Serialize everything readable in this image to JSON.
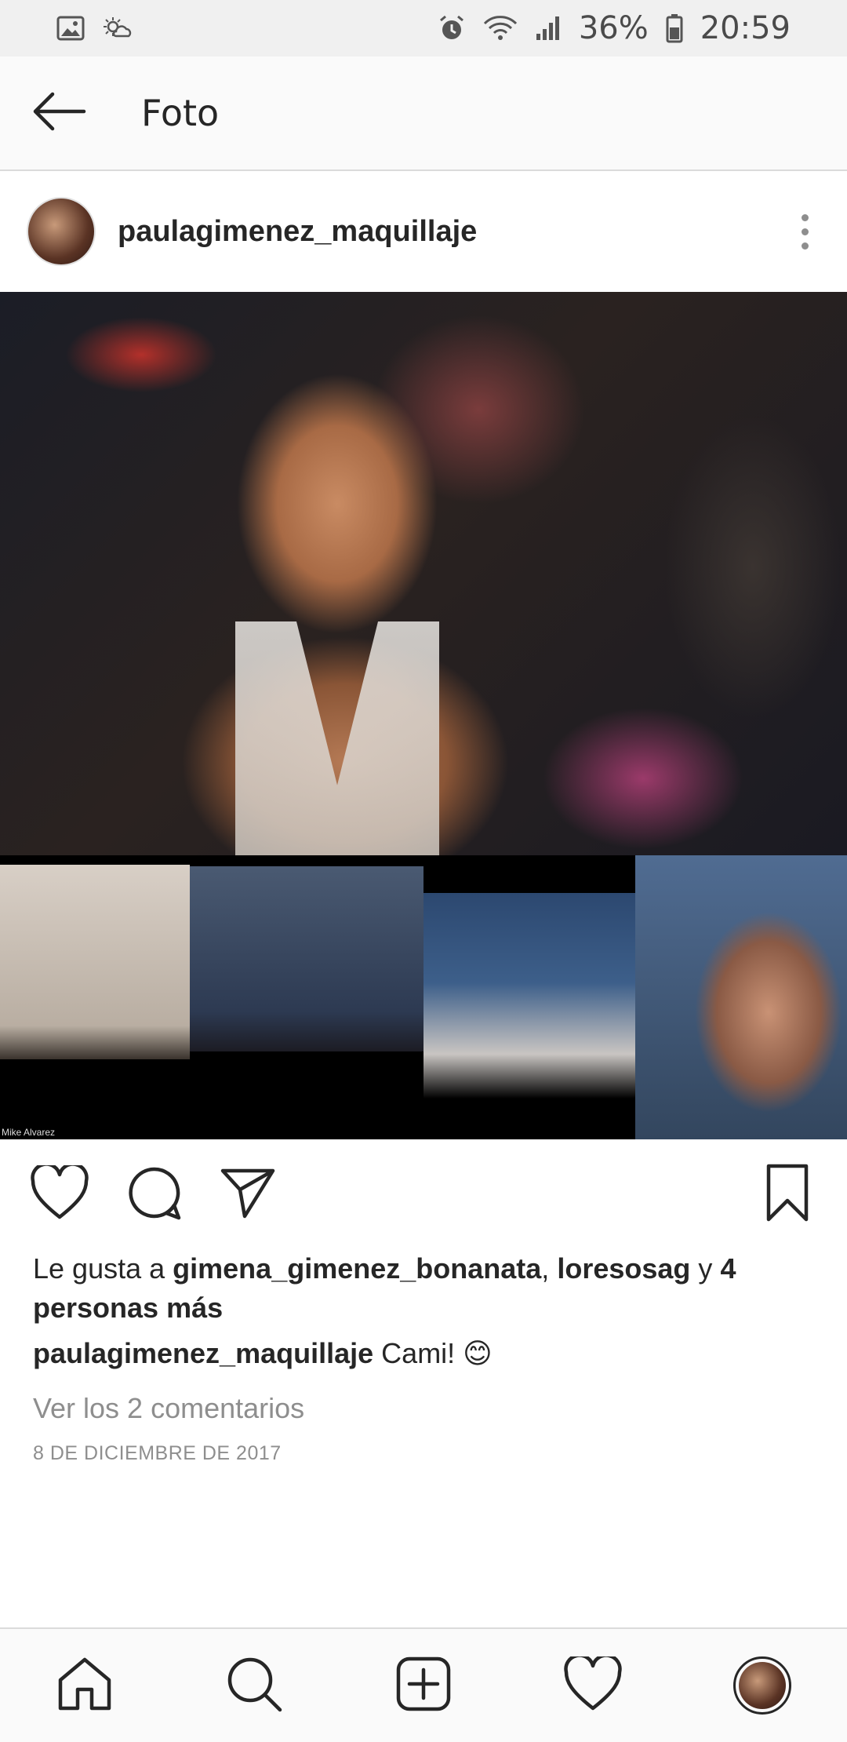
{
  "status_bar": {
    "battery": "36%",
    "time": "20:59",
    "icons": [
      "gallery-icon",
      "weather-icon",
      "alarm-icon",
      "wifi-icon",
      "signal-icon",
      "battery-icon"
    ]
  },
  "header": {
    "title": "Foto",
    "back_icon": "arrow-left-icon"
  },
  "post": {
    "username": "paulagimenez_maquillaje",
    "more_icon": "more-vertical-icon",
    "watermark": "Mike Alvarez",
    "likes": {
      "prefix": "Le gusta a",
      "user1": "gimena_gimenez_bonanata",
      "separator": ",",
      "user2": "loresosag",
      "connector": "y",
      "others": "4 personas más"
    },
    "caption": {
      "username": "paulagimenez_maquillaje",
      "text": "Cami! 😊"
    },
    "comments_link": "Ver los 2 comentarios",
    "date": "8 DE DICIEMBRE DE 2017"
  },
  "actions": [
    "heart-icon",
    "comment-icon",
    "share-icon",
    "bookmark-icon"
  ],
  "bottom_nav": [
    "home-icon",
    "search-icon",
    "add-icon",
    "activity-heart-icon",
    "profile-avatar"
  ],
  "colors": {
    "text": "#262626",
    "muted": "#8e8e8e",
    "bar": "#fafafa",
    "divider": "#dbdbdb"
  }
}
